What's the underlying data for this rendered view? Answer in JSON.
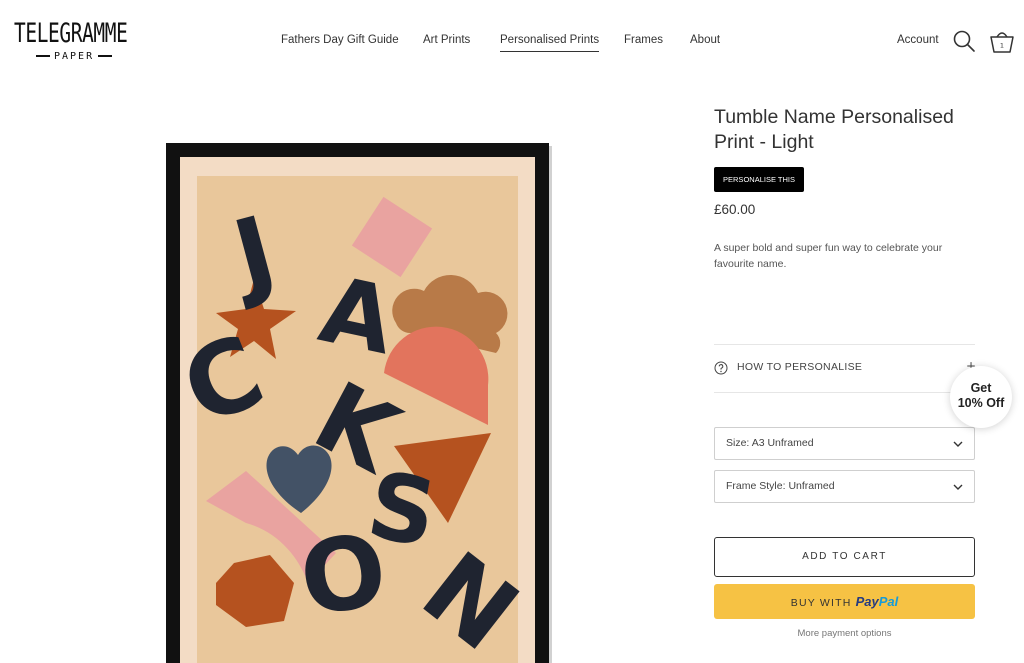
{
  "brand": {
    "name": "TELEGRAMME",
    "sub": "PAPER"
  },
  "nav": {
    "items": [
      "Fathers Day Gift Guide",
      "Art Prints",
      "Personalised Prints",
      "Frames",
      "About"
    ],
    "active": "Personalised Prints"
  },
  "header": {
    "account_label": "Account",
    "cart_count": "1"
  },
  "product": {
    "title": "Tumble Name Personalised Print - Light",
    "badge": "PERSONALISE THIS",
    "price": "£60.00",
    "description": "A super bold and super fun way to celebrate your favourite name.",
    "poster_name": "JACKSON"
  },
  "howto": {
    "label": "HOW TO PERSONALISE"
  },
  "options": {
    "size": {
      "label": "Size:",
      "value": "A3 Unframed"
    },
    "frame": {
      "label": "Frame Style:",
      "value": "Unframed"
    }
  },
  "actions": {
    "add_to_cart": "ADD TO CART",
    "buy_with": "BUY WITH",
    "paypal_a": "Pay",
    "paypal_b": "Pal",
    "more_options": "More payment options"
  },
  "offer": {
    "line1": "Get",
    "line2": "10% Off"
  },
  "colors": {
    "accent": "#f6c244",
    "poster_bg": "#e9c79b",
    "frame": "#111111",
    "ink": "#1f2430"
  }
}
